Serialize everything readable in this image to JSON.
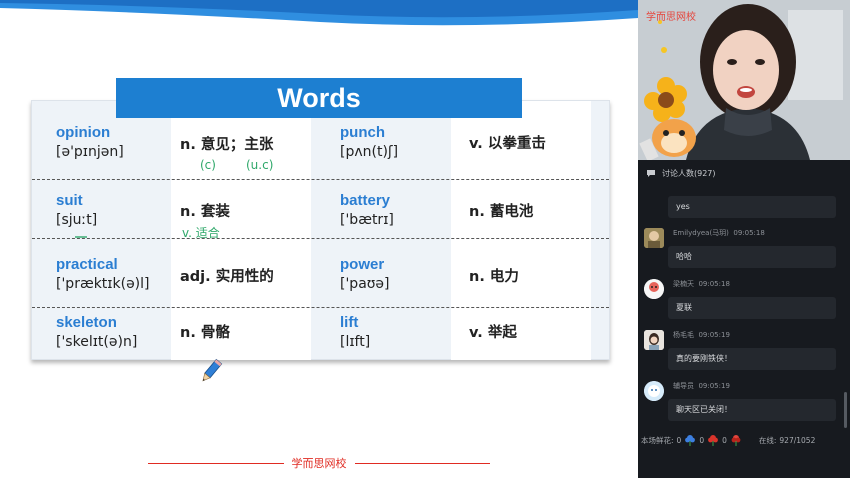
{
  "slide": {
    "title": "Words",
    "words": [
      {
        "en": "opinion",
        "ipa": "[ə'pɪnjən]",
        "meaning": "n. 意见；主张"
      },
      {
        "en": "punch",
        "ipa": "[pʌn(t)ʃ]",
        "meaning": "v. 以拳重击"
      },
      {
        "en": "suit",
        "ipa": "[sjuːt]",
        "meaning": "n. 套装"
      },
      {
        "en": "battery",
        "ipa": "['bætrɪ]",
        "meaning": "n. 蓄电池"
      },
      {
        "en": "practical",
        "ipa": "['præktɪk(ə)l]",
        "meaning": "adj. 实用性的"
      },
      {
        "en": "power",
        "ipa": "['paʊə]",
        "meaning": "n. 电力"
      },
      {
        "en": "skeleton",
        "ipa": "['skelɪt(ə)n]",
        "meaning": "n. 骨骼"
      },
      {
        "en": "lift",
        "ipa": "[lɪft]",
        "meaning": "v. 举起"
      }
    ],
    "handwriting": {
      "note1": "(c)",
      "note2": "(u.c)",
      "note3": "v. 适合"
    },
    "footer": "学而思网校"
  },
  "video": {
    "brand": "学而思网校"
  },
  "chat": {
    "header": "讨论人数(927)",
    "messages": [
      {
        "user": "",
        "time": "",
        "text": "yes",
        "avatar": "none"
      },
      {
        "user": "Emilydyea(马玥)",
        "time": "09:05:18",
        "text": "哈哈",
        "avatar": "photo"
      },
      {
        "user": "梁楠天",
        "time": "09:05:18",
        "text": "夏联",
        "avatar": "cartoon-red"
      },
      {
        "user": "杨毛毛",
        "time": "09:05:19",
        "text": "真的要刚铁侠！",
        "avatar": "girl-photo"
      },
      {
        "user": "辅导员",
        "time": "09:05:19",
        "text": "聊天区已关闭！",
        "avatar": "cartoon-blue"
      }
    ]
  },
  "flowers": {
    "label": "本场鲜花:",
    "counts": [
      "0",
      "0",
      "0"
    ],
    "online_label": "在线:",
    "online": "927/1052"
  },
  "colors": {
    "accent": "#1d7fd1",
    "word_blue": "#2b7ed2",
    "brand_red": "#e02b22",
    "panel_bg": "#171a1f"
  },
  "icons": [
    "pencil-icon",
    "chat-icon",
    "flower-icon"
  ]
}
